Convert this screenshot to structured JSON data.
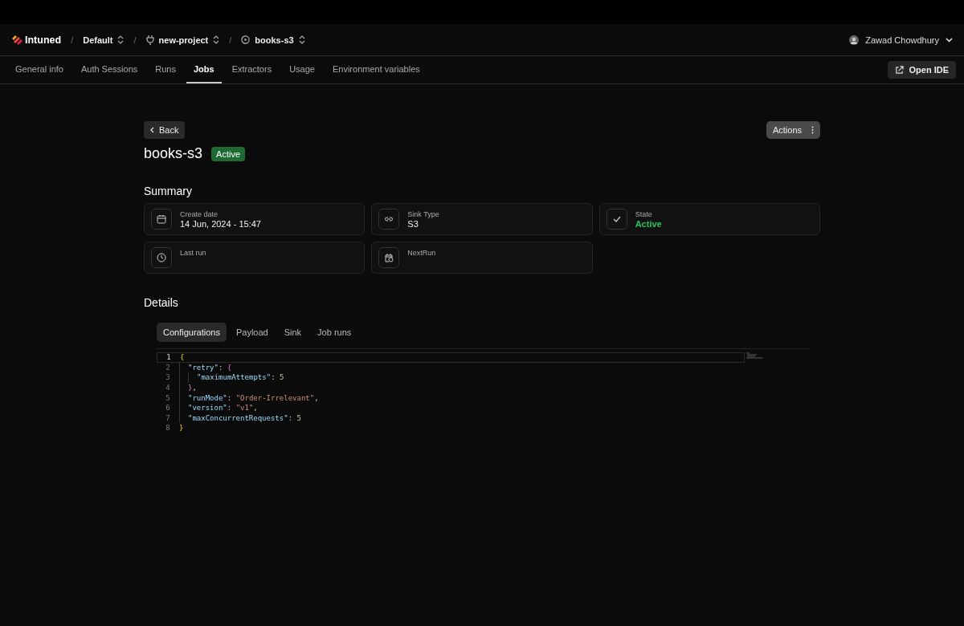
{
  "header": {
    "logo": "Intuned",
    "breadcrumbs": [
      {
        "label": "Default"
      },
      {
        "label": "new-project"
      },
      {
        "label": "books-s3"
      }
    ],
    "separator": "/",
    "user": "Zawad Chowdhury"
  },
  "tabs": [
    {
      "label": "General info",
      "selected": false
    },
    {
      "label": "Auth Sessions",
      "selected": false
    },
    {
      "label": "Runs",
      "selected": false
    },
    {
      "label": "Jobs",
      "selected": true
    },
    {
      "label": "Extractors",
      "selected": false
    },
    {
      "label": "Usage",
      "selected": false
    },
    {
      "label": "Environment variables",
      "selected": false
    }
  ],
  "open_ide": "Open IDE",
  "back": "Back",
  "actions": "Actions",
  "job": {
    "title": "books-s3",
    "status": "Active"
  },
  "summary": {
    "title": "Summary",
    "cards": [
      {
        "label": "Create date",
        "value": "14 Jun, 2024 - 15:47",
        "kind": "plain"
      },
      {
        "label": "Sink Type",
        "value": "S3",
        "kind": "plain"
      },
      {
        "label": "State",
        "value": "Active",
        "kind": "status"
      },
      {
        "label": "Last run"
      },
      {
        "label": "NextRun"
      }
    ]
  },
  "details": {
    "title": "Details",
    "tabs": [
      {
        "label": "Configurations",
        "selected": true
      },
      {
        "label": "Payload",
        "selected": false
      },
      {
        "label": "Sink",
        "selected": false
      },
      {
        "label": "Job runs",
        "selected": false
      }
    ],
    "code": [
      {
        "number": "1",
        "tokens": [
          {
            "text": "{",
            "kind": "brace"
          }
        ],
        "children": [
          {
            "number": "2",
            "tokens": [
              {
                "text": "\"retry\"",
                "kind": "key"
              },
              {
                "text": ": ",
                "kind": "punct"
              },
              {
                "text": "{",
                "kind": "brace2"
              }
            ],
            "children": [
              {
                "number": "3",
                "tokens": [
                  {
                    "text": "\"maximumAttempts\"",
                    "kind": "key"
                  },
                  {
                    "text": ": ",
                    "kind": "punct"
                  },
                  {
                    "text": "5",
                    "kind": "number"
                  }
                ]
              }
            ]
          },
          {
            "number": "4",
            "tokens": [
              {
                "text": "}",
                "kind": "brace2"
              },
              {
                "text": ",",
                "kind": "punct"
              }
            ]
          },
          {
            "number": "5",
            "tokens": [
              {
                "text": "\"runMode\"",
                "kind": "key"
              },
              {
                "text": ": ",
                "kind": "punct"
              },
              {
                "text": "\"Order-Irrelevant\"",
                "kind": "string"
              },
              {
                "text": ",",
                "kind": "punct"
              }
            ]
          },
          {
            "number": "6",
            "tokens": [
              {
                "text": "\"version\"",
                "kind": "key"
              },
              {
                "text": ": ",
                "kind": "punct"
              },
              {
                "text": "\"v1\"",
                "kind": "string"
              },
              {
                "text": ",",
                "kind": "punct"
              }
            ]
          },
          {
            "number": "7",
            "tokens": [
              {
                "text": "\"maxConcurrentRequests\"",
                "kind": "key"
              },
              {
                "text": ": ",
                "kind": "punct"
              },
              {
                "text": "5",
                "kind": "number"
              }
            ]
          }
        ]
      },
      {
        "number": "8",
        "tokens": [
          {
            "text": "}",
            "kind": "brace"
          }
        ]
      }
    ]
  }
}
